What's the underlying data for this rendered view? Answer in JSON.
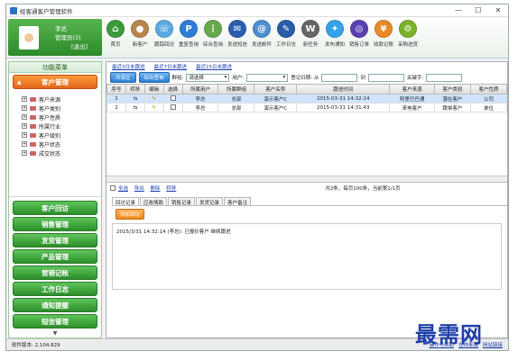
{
  "window": {
    "title": "经客通客户管理软件",
    "minimize": "—",
    "maximize": "☐",
    "close": "✕"
  },
  "user": {
    "name": "李总",
    "role": "管理员(3)",
    "logout": "[退出]"
  },
  "toolbar": [
    {
      "label": "首页",
      "icon": "home-icon",
      "color": "#3a9a3a",
      "glyph": "⌂"
    },
    {
      "label": "新客户",
      "icon": "new-customer-icon",
      "color": "#b8864a",
      "glyph": "●"
    },
    {
      "label": "跟踪回访",
      "icon": "followup-icon",
      "color": "#5aa9e0",
      "glyph": "☏"
    },
    {
      "label": "重复查询",
      "icon": "duplicate-search-icon",
      "color": "#2e7dd6",
      "glyph": "P"
    },
    {
      "label": "综合查询",
      "icon": "search-icon",
      "color": "#6aa84f",
      "glyph": "⋮"
    },
    {
      "label": "发送短信",
      "icon": "sms-icon",
      "color": "#2b5fae",
      "glyph": "✉"
    },
    {
      "label": "发送邮件",
      "icon": "email-icon",
      "color": "#4d8fcf",
      "glyph": "@"
    },
    {
      "label": "工作日志",
      "icon": "worklog-icon",
      "color": "#2a5ca8",
      "glyph": "✎"
    },
    {
      "label": "新任务",
      "icon": "task-icon",
      "color": "#666666",
      "glyph": "W"
    },
    {
      "label": "发布通知",
      "icon": "notice-icon",
      "color": "#36a3e8",
      "glyph": "✦"
    },
    {
      "label": "销售订单",
      "icon": "order-icon",
      "color": "#5a3fb0",
      "glyph": "◎"
    },
    {
      "label": "收款记账",
      "icon": "payment-icon",
      "color": "#e88a2a",
      "glyph": "¥"
    },
    {
      "label": "采购进货",
      "icon": "purchase-icon",
      "color": "#7ab32a",
      "glyph": "⚙"
    }
  ],
  "sidebar": {
    "header": "功能菜单",
    "active": "客户管理",
    "tree": [
      "客户来源",
      "客户类别",
      "客户性质",
      "所属行业",
      "客户级别",
      "客户状态",
      "成交状态"
    ],
    "items": [
      "客户回访",
      "销售管理",
      "发货管理",
      "产品管理",
      "营销记帐",
      "工作日志",
      "通知提醒",
      "短信管理"
    ]
  },
  "links": [
    "最近3日未跟进",
    "最近7日未跟进",
    "最近15日未跟进"
  ],
  "filter": {
    "share_btn": "共享区",
    "combo_btn": "综合查询",
    "group_label": "群组:",
    "group_value": "请选择",
    "user_label": "用户:",
    "date_label": "登记日期: 从",
    "to_label": "到",
    "keyword_label": "关键字:"
  },
  "table": {
    "headers": [
      "序号",
      "转移",
      "编辑",
      "选择",
      "所属用户",
      "所属群组",
      "客户名称",
      "跟进时间",
      "客户来源",
      "客户类别",
      "客户性质"
    ],
    "rows": [
      [
        "1",
        "李总",
        "总部",
        "演示客户C",
        "2015-03-31 14:32:14",
        "阿里巴巴通",
        "潜在客户",
        "公司"
      ],
      [
        "2",
        "李总",
        "总部",
        "演示客户C",
        "2015-03-31 14:31:43",
        "来电客户",
        "跟单客户",
        "单位"
      ]
    ]
  },
  "pager": {
    "select_all": "全选",
    "export": "导出",
    "delete": "删除",
    "transfer": "转移",
    "info": "共2条，每页100条，当前第1/1页"
  },
  "tabs": [
    "回访记录",
    "应收情款",
    "销售记录",
    "发货记录",
    "客户备注"
  ],
  "add_btn": "添加回访",
  "log_entry": "2015/3/31 14:32:14 (李总): 已报价客户 继续跟进",
  "status": {
    "version": "软件版本: 2.104.829",
    "links": [
      "操作与帮助",
      "在线客服",
      "网站链接"
    ]
  },
  "watermark": "最需网"
}
